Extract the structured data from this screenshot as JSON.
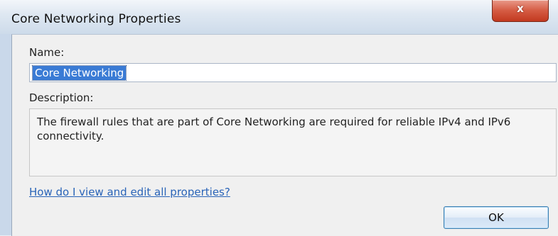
{
  "window": {
    "title": "Core Networking Properties",
    "close_glyph": "x",
    "close_icon": "close-icon"
  },
  "form": {
    "name_label": "Name:",
    "name_value": "Core Networking",
    "description_label": "Description:",
    "description_text": "The firewall rules that are part of Core Networking are required for reliable IPv4 and IPv6 connectivity."
  },
  "footer": {
    "help_link": "How do I view and edit all properties?",
    "ok_label": "OK"
  },
  "colors": {
    "close_button": "#c2391f",
    "link": "#2a64b8",
    "selection": "#3a7bd5"
  }
}
